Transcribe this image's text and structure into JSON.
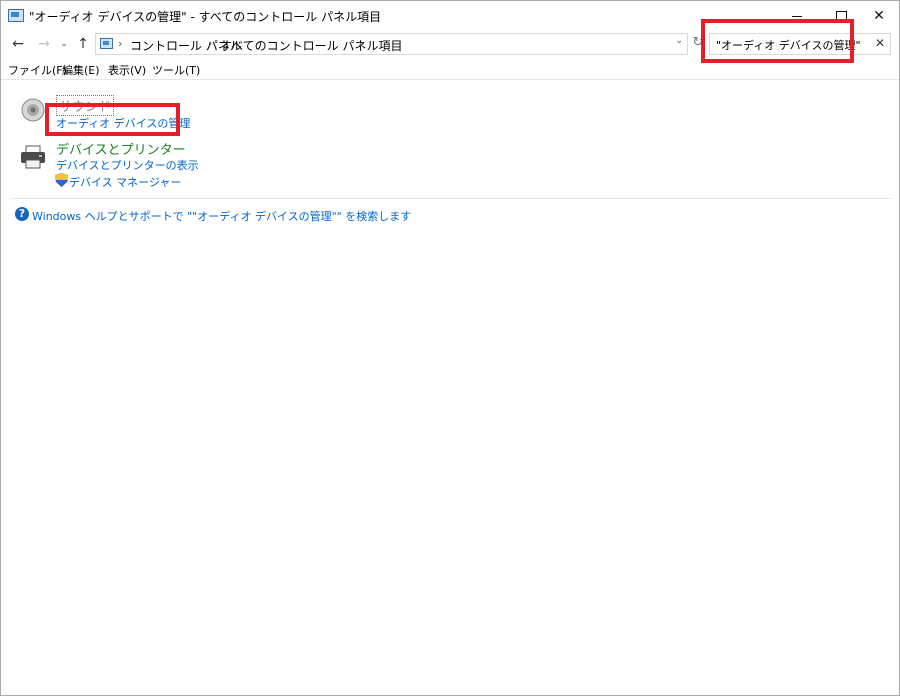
{
  "window": {
    "title": "\"オーディオ デバイスの管理\" - すべてのコントロール パネル項目",
    "controls": {
      "minimize": "—",
      "maximize": "□",
      "close": "✕"
    }
  },
  "nav": {
    "back_icon": "arrow-left",
    "forward_icon": "arrow-right",
    "recent_icon": "chevron-down",
    "up_icon": "arrow-up",
    "breadcrumb": [
      "コントロール パネル",
      "すべてのコントロール パネル項目"
    ],
    "refresh_icon": "refresh",
    "search_value": "\"オーディオ デバイスの管理\""
  },
  "menu": {
    "items": [
      "ファイル(F)",
      "編集(E)",
      "表示(V)",
      "ツール(T)"
    ]
  },
  "content": {
    "categories": [
      {
        "title": "サウンド",
        "icon": "speaker-icon",
        "links": [
          "オーディオ デバイスの管理"
        ]
      },
      {
        "title": "デバイスとプリンター",
        "icon": "printer-icon",
        "links": [
          "デバイスとプリンターの表示",
          "デバイス マネージャー"
        ]
      }
    ],
    "help_link": "Windows ヘルプとサポートで \"\"オーディオ デバイスの管理\"\" を検索します"
  },
  "colors": {
    "highlight": "#e2202a",
    "link": "#0066cc",
    "category_green": "#1e7e1e"
  }
}
